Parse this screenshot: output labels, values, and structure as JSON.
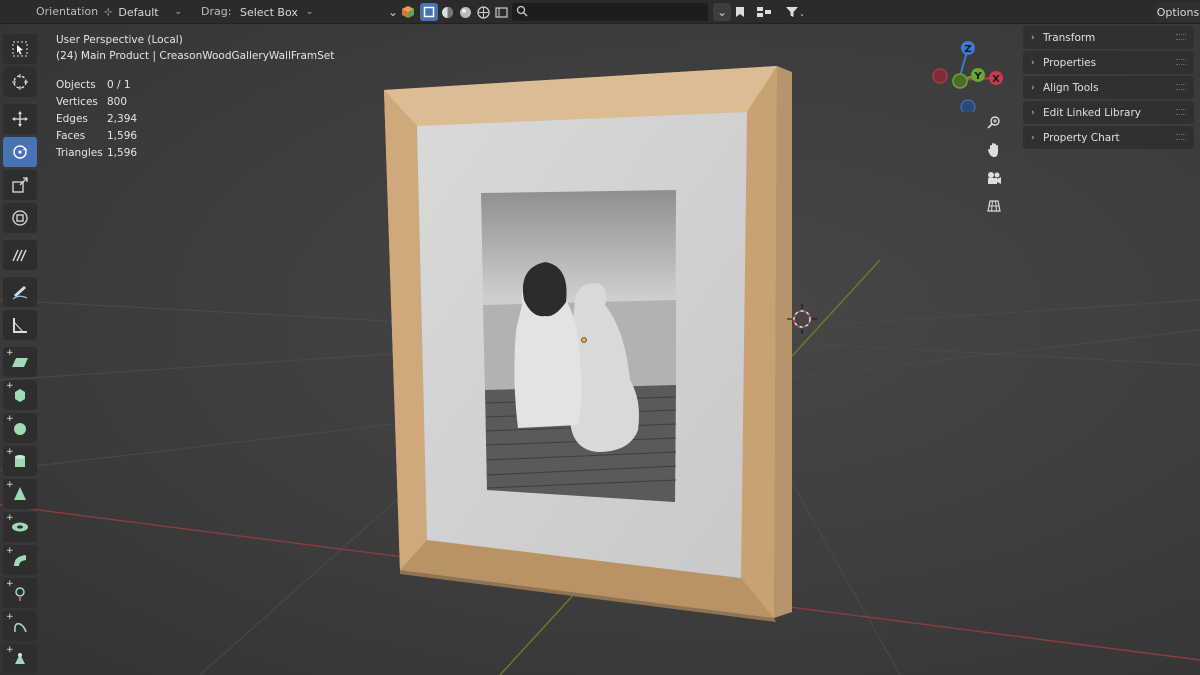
{
  "header": {
    "orientation_label": "Orientation:",
    "orientation_value": "Default",
    "drag_label": "Drag:",
    "drag_value": "Select Box",
    "options_label": "Options",
    "search_placeholder": ""
  },
  "viewport": {
    "title": "User Perspective (Local)",
    "object_name": "(24) Main Product | CreasonWoodGalleryWallFramSet",
    "stats": [
      {
        "key": "Objects",
        "value": "0 / 1"
      },
      {
        "key": "Vertices",
        "value": "800"
      },
      {
        "key": "Edges",
        "value": "2,394"
      },
      {
        "key": "Faces",
        "value": "1,596"
      },
      {
        "key": "Triangles",
        "value": "1,596"
      }
    ]
  },
  "sidebar": {
    "panels": [
      {
        "label": "Transform"
      },
      {
        "label": "Properties"
      },
      {
        "label": "Align Tools"
      },
      {
        "label": "Edit Linked Library"
      },
      {
        "label": "Property Chart"
      }
    ]
  },
  "gizmo": {
    "z": "Z",
    "y": "Y",
    "x": "X"
  },
  "icons": {
    "toolbar": [
      "select-box-icon",
      "cursor-icon",
      "move-icon",
      "rotate-icon",
      "scale-icon",
      "transform-icon",
      "annotate-icon",
      "draw-icon",
      "measure-icon",
      "add-plane-icon",
      "add-cube-icon",
      "add-sphere-icon",
      "add-cylinder-icon",
      "add-cone-icon",
      "add-torus-icon",
      "add-curve-icon",
      "add-empty-icon",
      "add-path-icon",
      "add-light-icon"
    ],
    "nav": [
      "zoom-icon",
      "pan-icon",
      "camera-icon",
      "grid-icon"
    ]
  },
  "colors": {
    "accent": "#4772b3",
    "axis_x": "#c43c4e",
    "axis_y": "#6aa72e",
    "axis_z": "#3c7bd4"
  }
}
